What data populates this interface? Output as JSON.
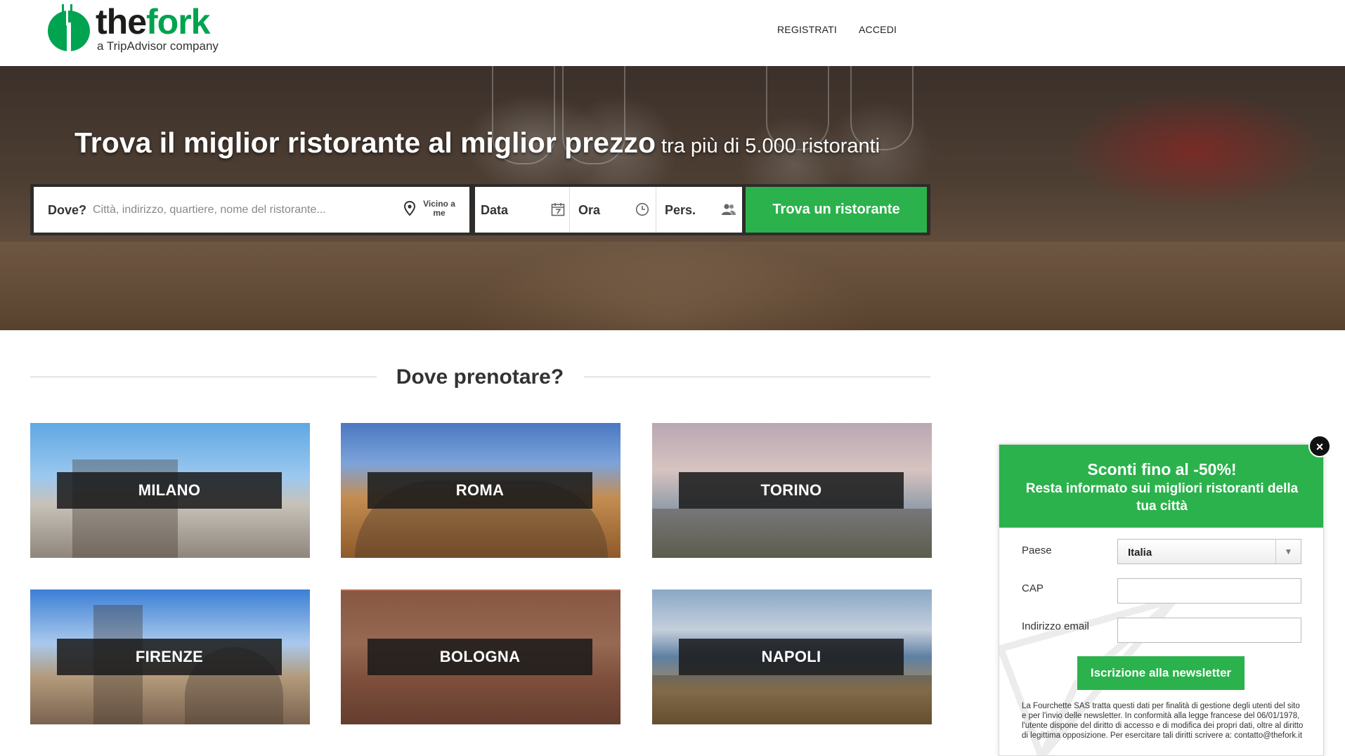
{
  "header": {
    "logo_text_the": "the",
    "logo_text_fork": "fork",
    "logo_sub": "a TripAdvisor company",
    "nav": {
      "register": "REGISTRATI",
      "login": "ACCEDI"
    }
  },
  "hero": {
    "title_main": "Trova il miglior ristorante al miglior prezzo",
    "title_sub": "tra più di 5.000 ristoranti"
  },
  "search": {
    "where_label": "Dove?",
    "where_placeholder": "Città, indirizzo, quartiere, nome del ristorante...",
    "near_me": "Vicino a me",
    "date_label": "Data",
    "time_label": "Ora",
    "pers_label": "Pers.",
    "button": "Trova un ristorante"
  },
  "section": {
    "title": "Dove prenotare?"
  },
  "cities": [
    {
      "name": "MILANO"
    },
    {
      "name": "ROMA"
    },
    {
      "name": "TORINO"
    },
    {
      "name": "FIRENZE"
    },
    {
      "name": "BOLOGNA"
    },
    {
      "name": "NAPOLI"
    }
  ],
  "newsletter": {
    "title": "Sconti fino al -50%!",
    "subtitle": "Resta informato sui migliori ristoranti della tua città",
    "country_label": "Paese",
    "country_value": "Italia",
    "cap_label": "CAP",
    "cap_value": "",
    "email_label": "Indirizzo email",
    "email_value": "",
    "button": "Iscrizione alla newsletter",
    "legal": "La Fourchette SAS tratta questi dati per finalità di gestione degli utenti del sito e per l'invio delle newsletter. In conformità alla legge francese del 06/01/1978, l'utente dispone del diritto di accesso e di modifica dei propri dati, oltre al diritto di legittima opposizione. Per esercitare tali diritti scrivere a: contatto@thefork.it",
    "close": "×"
  },
  "colors": {
    "brand_green": "#2bb24c",
    "logo_green": "#00a34f"
  }
}
